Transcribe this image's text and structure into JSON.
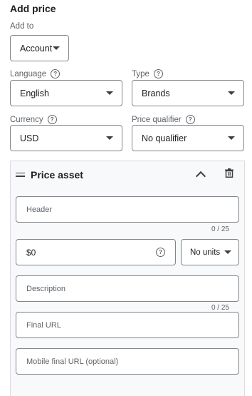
{
  "title": "Add price",
  "add_to": {
    "label": "Add to",
    "value": "Account"
  },
  "language": {
    "label": "Language",
    "value": "English"
  },
  "type": {
    "label": "Type",
    "value": "Brands"
  },
  "currency": {
    "label": "Currency",
    "value": "USD"
  },
  "price_qualifier": {
    "label": "Price qualifier",
    "value": "No qualifier"
  },
  "help_glyph": "?",
  "price_asset": {
    "title": "Price asset",
    "header": {
      "placeholder": "Header",
      "counter": "0 / 25"
    },
    "price": {
      "value": "$0"
    },
    "units": {
      "value": "No units"
    },
    "description": {
      "placeholder": "Description",
      "counter": "0 / 25"
    },
    "final_url": {
      "placeholder": "Final URL"
    },
    "mobile_final_url": {
      "placeholder": "Mobile final URL (optional)"
    }
  },
  "icons": [
    "help-icon",
    "chevron-down-icon",
    "drag-handle-icon",
    "chevron-up-icon",
    "trash-icon"
  ]
}
